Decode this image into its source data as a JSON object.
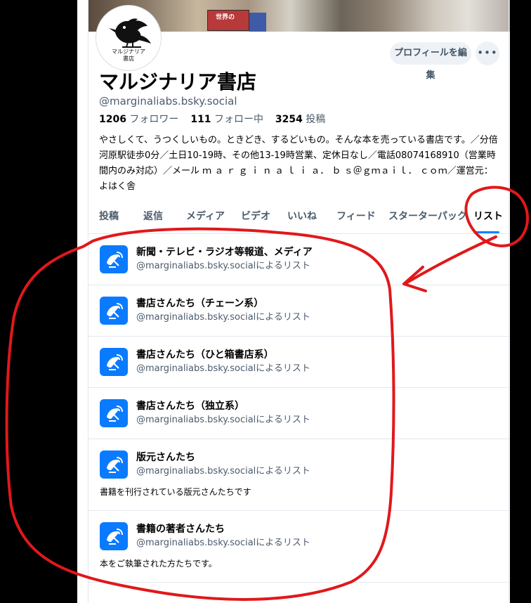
{
  "banner": {
    "book_title": "世界の"
  },
  "profile": {
    "avatar_caption_line1": "マルジナリア",
    "avatar_caption_line2": "書店",
    "edit_button": "プロフィールを編集",
    "more_button": "•••",
    "display_name": "マルジナリア書店",
    "handle": "@marginaliabs.bsky.social",
    "stats": {
      "followers_count": "1206",
      "followers_label": "フォロワー",
      "following_count": "111",
      "following_label": "フォロー中",
      "posts_count": "3254",
      "posts_label": "投稿"
    },
    "bio": "やさしくて、うつくしいもの。ときどき、するどいもの。そんな本を売っている書店です。／分倍河原駅徒歩0分／土日10-19時、その他13-19時営業、定休日なし／電話08074168910（営業時間内のみ対応）／メール ｍ ａ ｒ ｇ ｉ ｎ ａ ｌ ｉ ａ． ｂ ｓ＠ｇｍａｉｌ． ｃｏｍ／運営元：よはく舎"
  },
  "tabs": [
    {
      "label": "投稿"
    },
    {
      "label": "返信"
    },
    {
      "label": "メディア"
    },
    {
      "label": "ビデオ"
    },
    {
      "label": "いいね"
    },
    {
      "label": "フィード"
    },
    {
      "label": "スターターパック"
    },
    {
      "label": "リスト",
      "active": true
    }
  ],
  "lists": [
    {
      "title": "新聞・テレビ・ラジオ等報道、メディア",
      "by": "@marginaliabs.bsky.socialによるリスト",
      "description": ""
    },
    {
      "title": "書店さんたち（チェーン系）",
      "by": "@marginaliabs.bsky.socialによるリスト",
      "description": ""
    },
    {
      "title": "書店さんたち（ひと箱書店系）",
      "by": "@marginaliabs.bsky.socialによるリスト",
      "description": ""
    },
    {
      "title": "書店さんたち（独立系）",
      "by": "@marginaliabs.bsky.socialによるリスト",
      "description": ""
    },
    {
      "title": "版元さんたち",
      "by": "@marginaliabs.bsky.socialによるリスト",
      "description": "書籍を刊行されている版元さんたちです"
    },
    {
      "title": "書籍の著者さんたち",
      "by": "@marginaliabs.bsky.socialによるリスト",
      "description": "本をご執筆された方たちです。"
    }
  ],
  "colors": {
    "accent": "#1083fe",
    "list_icon_bg": "#0a7aff",
    "annotation": "#e0181b",
    "muted_text": "#4b5b6c"
  },
  "icons": {
    "list_icon": "satellite-dish-icon",
    "avatar": "bird-logo-icon"
  }
}
